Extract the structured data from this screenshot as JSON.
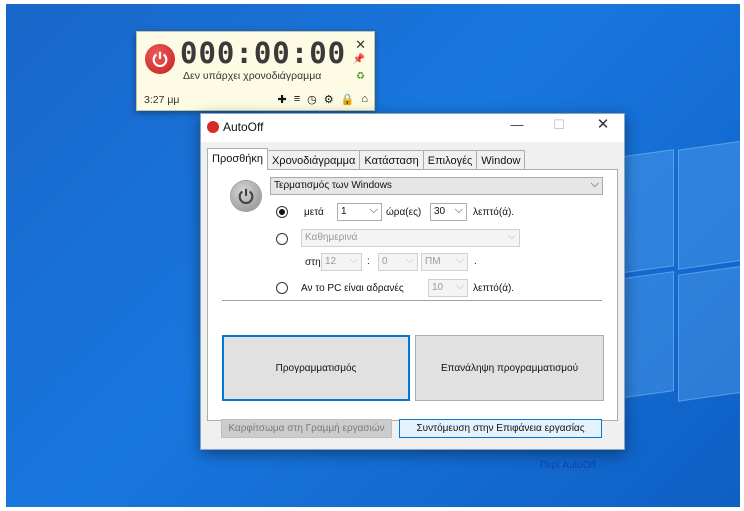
{
  "widget": {
    "timer": "000:00:00",
    "status": "Δεν υπάρχει χρονοδιάγραμμα",
    "clock": "3:27 μμ",
    "icons": [
      "close-icon",
      "pin-icon",
      "leaf-icon",
      "plus-icon",
      "menu-icon",
      "clock-icon",
      "gear-icon",
      "lock-icon",
      "home-icon"
    ]
  },
  "window": {
    "title": "AutoOff",
    "tabs": [
      "Προσθήκη",
      "Χρονοδιάγραμμα",
      "Κατάσταση",
      "Επιλογές",
      "Window"
    ],
    "action_select": "Τερματισμός των Windows",
    "option_after": {
      "label": "μετά",
      "hours": "1",
      "hours_unit": "ώρα(ες)",
      "minutes": "30",
      "minutes_unit": "λεπτό(ά)."
    },
    "option_daily": {
      "frequency": "Καθημερινά",
      "at_label": "στη",
      "hour": "12",
      "colon": ":",
      "minute": "0",
      "ampm": "ΠΜ",
      "dot": "."
    },
    "option_idle": {
      "label": "Αν το PC είναι αδρανές",
      "minutes": "10",
      "minutes_unit": "λεπτό(ά)."
    },
    "schedule_button": "Προγραμματισμός",
    "repeat_button": "Επανάληψη προγραμματισμού",
    "pin_taskbar_button": "Καρφίτσωμα στη Γραμμή εργασιών",
    "desktop_shortcut_button": "Συντόμευση στην Επιφάνεια εργασίας",
    "about_link": "Περί AutoOff"
  }
}
